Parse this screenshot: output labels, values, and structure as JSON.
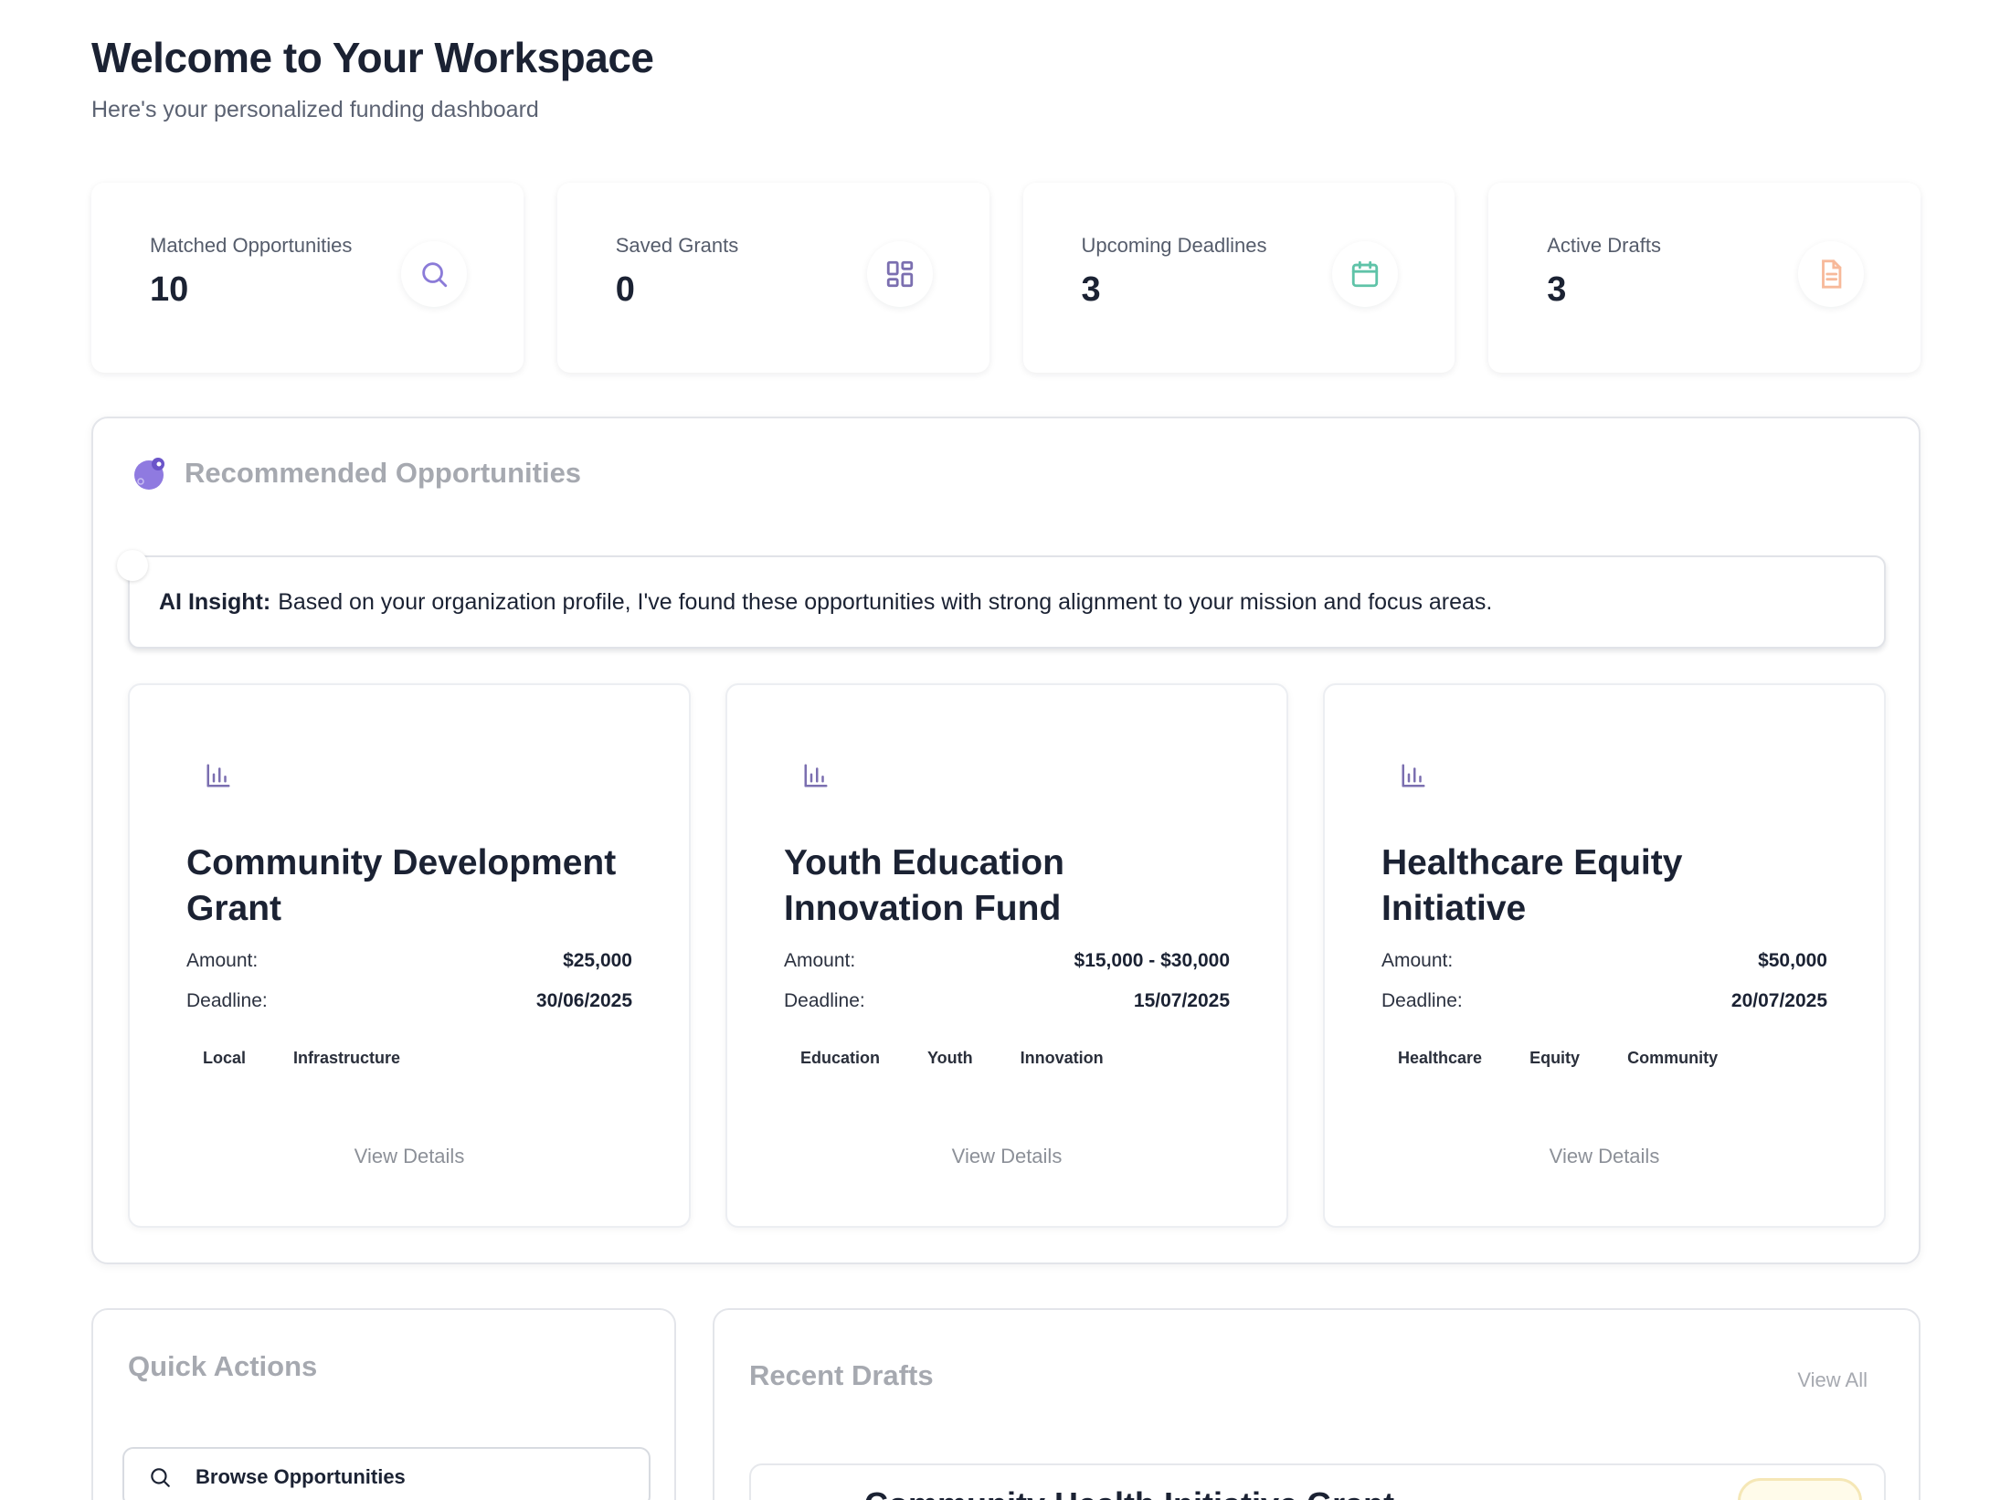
{
  "header": {
    "title": "Welcome to Your Workspace",
    "subtitle": "Here's your personalized funding dashboard"
  },
  "stats": [
    {
      "label": "Matched Opportunities",
      "value": "10",
      "icon": "search-icon",
      "color": "#8b7bd8"
    },
    {
      "label": "Saved Grants",
      "value": "0",
      "icon": "grid-icon",
      "color": "#7b6fb0"
    },
    {
      "label": "Upcoming Deadlines",
      "value": "3",
      "icon": "calendar-icon",
      "color": "#5fc3a8"
    },
    {
      "label": "Active Drafts",
      "value": "3",
      "icon": "document-icon",
      "color": "#f7b99a"
    }
  ],
  "recommended": {
    "title": "Recommended Opportunities",
    "insight_label": "AI Insight:",
    "insight_text": "Based on your organization profile, I've found these opportunities with strong alignment to your mission and focus areas.",
    "amount_label": "Amount:",
    "deadline_label": "Deadline:",
    "view_details_label": "View Details",
    "cards": [
      {
        "title": "Community Development Grant",
        "amount": "$25,000",
        "deadline": "30/06/2025",
        "tags": [
          "Local",
          "Infrastructure"
        ]
      },
      {
        "title": "Youth Education Innovation Fund",
        "amount": "$15,000 - $30,000",
        "deadline": "15/07/2025",
        "tags": [
          "Education",
          "Youth",
          "Innovation"
        ]
      },
      {
        "title": "Healthcare Equity Initiative",
        "amount": "$50,000",
        "deadline": "20/07/2025",
        "tags": [
          "Healthcare",
          "Equity",
          "Community"
        ]
      }
    ]
  },
  "quick_actions": {
    "title": "Quick Actions",
    "browse_label": "Browse Opportunities"
  },
  "recent_drafts": {
    "title": "Recent Drafts",
    "view_all_label": "View All",
    "first_item_title": "Community Health Initiative Grant"
  },
  "colors": {
    "accent_purple": "#7b6fb0",
    "muted_text": "#a6a9b0"
  }
}
